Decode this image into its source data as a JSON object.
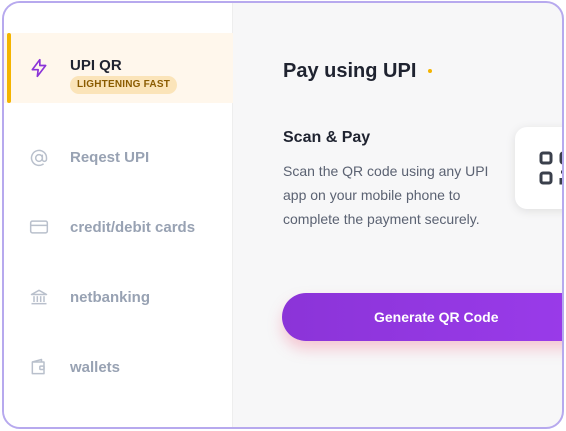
{
  "sidebar": {
    "items": [
      {
        "label": "UPI QR",
        "icon": "lightning-icon",
        "active": true,
        "badge": "LIGHTENING FAST"
      },
      {
        "label": "Reqest UPI",
        "icon": "at-sign-icon"
      },
      {
        "label": "credit/debit cards",
        "icon": "credit-card-icon"
      },
      {
        "label": "netbanking",
        "icon": "bank-icon"
      },
      {
        "label": "wallets",
        "icon": "wallet-icon"
      }
    ]
  },
  "main": {
    "title": "Pay using UPI",
    "section_title": "Scan & Pay",
    "description": "Scan the QR code using any UPI app on your mobile phone to complete the payment securely.",
    "qr_icon": "qr-code-icon",
    "generate_button": "Generate QR Code"
  },
  "colors": {
    "accent": "#9a3bea",
    "active_bar": "#f4b400",
    "active_bg": "#fff7ec",
    "badge_bg": "#fbe4b9",
    "border": "#b7a9ee"
  }
}
